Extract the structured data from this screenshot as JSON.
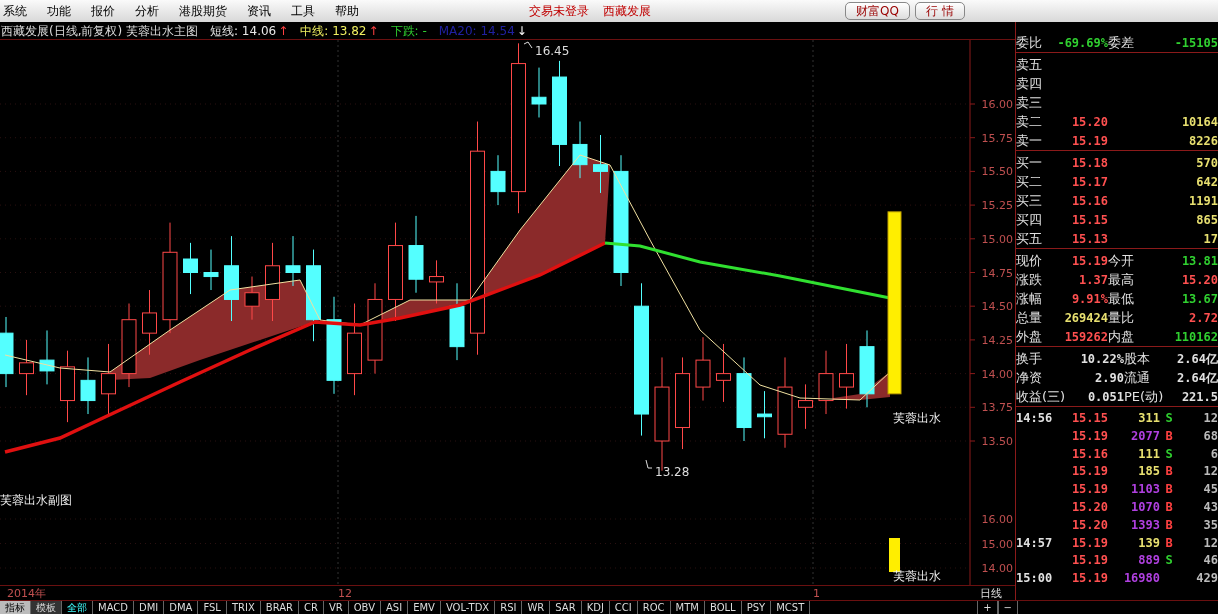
{
  "menu_bar": {
    "items": [
      "系统",
      "功能",
      "报价",
      "分析",
      "港股期货",
      "资讯",
      "工具",
      "帮助"
    ],
    "login_status": "交易未登录",
    "stock_name": "西藏发展",
    "buttons": [
      "财富QQ",
      "行 情"
    ]
  },
  "chart_header": {
    "title": "西藏发展(日线,前复权) 芙蓉出水主图",
    "indicators": [
      {
        "label": "短线:",
        "value": "14.06",
        "arrow": "↑",
        "color": "#e8e8e8"
      },
      {
        "label": "中线:",
        "value": "13.82",
        "arrow": "↑",
        "color": "#f0f060"
      },
      {
        "label": "下跌:",
        "value": "-",
        "color": "#30d030"
      },
      {
        "label": "MA20:",
        "value": "14.54",
        "arrow": "↓",
        "color": "#2020a0"
      }
    ]
  },
  "main_chart": {
    "y_axis": [
      "16.00",
      "15.75",
      "15.50",
      "15.25",
      "15.00",
      "14.75",
      "14.50",
      "14.25",
      "14.00",
      "13.75",
      "13.50"
    ],
    "high_label": "16.45",
    "low_label": "13.28",
    "signal_label": "芙蓉出水"
  },
  "sub_chart": {
    "title": "芙蓉出水副图",
    "y_axis": [
      "16.00",
      "15.00",
      "14.00"
    ],
    "signal_label": "芙蓉出水"
  },
  "date_axis": [
    "2014年",
    "12",
    "1"
  ],
  "period": "日线",
  "quote_panel": {
    "commission": {
      "label": "委比",
      "value": "-69.69%",
      "label2": "委差",
      "value2": "-15105"
    },
    "asks": [
      {
        "label": "卖五"
      },
      {
        "label": "卖四"
      },
      {
        "label": "卖三"
      },
      {
        "label": "卖二",
        "price": "15.20",
        "volume": "10164"
      },
      {
        "label": "卖一",
        "price": "15.19",
        "volume": "8226"
      }
    ],
    "bids": [
      {
        "label": "买一",
        "price": "15.18",
        "volume": "570"
      },
      {
        "label": "买二",
        "price": "15.17",
        "volume": "642"
      },
      {
        "label": "买三",
        "price": "15.16",
        "volume": "1191"
      },
      {
        "label": "买四",
        "price": "15.15",
        "volume": "865"
      },
      {
        "label": "买五",
        "price": "15.13",
        "volume": "17"
      }
    ],
    "stats": [
      {
        "cells": [
          {
            "label": "现价",
            "value": "15.19",
            "color": "#ff5050"
          },
          {
            "label": "今开",
            "value": "13.81",
            "color": "#30d030"
          }
        ]
      },
      {
        "cells": [
          {
            "label": "涨跌",
            "value": "1.37",
            "color": "#ff5050"
          },
          {
            "label": "最高",
            "value": "15.20",
            "color": "#ff5050"
          }
        ]
      },
      {
        "cells": [
          {
            "label": "涨幅",
            "value": "9.91%",
            "color": "#ff5050"
          },
          {
            "label": "最低",
            "value": "13.67",
            "color": "#30d030"
          }
        ]
      },
      {
        "cells": [
          {
            "label": "总量",
            "value": "269424",
            "color": "#e8e070"
          },
          {
            "label": "量比",
            "value": "2.72",
            "color": "#ff5050"
          }
        ]
      },
      {
        "cells": [
          {
            "label": "外盘",
            "value": "159262",
            "color": "#ff5050"
          },
          {
            "label": "内盘",
            "value": "110162",
            "color": "#30d030"
          }
        ]
      }
    ],
    "fundamentals": [
      {
        "label": "换手",
        "value": "10.22%",
        "label2": "股本",
        "value2": "2.64亿"
      },
      {
        "label": "净资",
        "value": "2.90",
        "label2": "流通",
        "value2": "2.64亿"
      },
      {
        "label": "收益(三)",
        "value": "0.051",
        "label2": "PE(动)",
        "value2": "221.5"
      }
    ],
    "ticks": [
      {
        "time": "14:56",
        "price": "15.15",
        "volume": {
          "text": "311",
          "color": "#e8e070"
        },
        "side": {
          "text": "S",
          "kind": "sell"
        },
        "count": "12"
      },
      {
        "price": "15.19",
        "volume": {
          "text": "2077",
          "color": "#b040e0"
        },
        "side": {
          "text": "B",
          "kind": "buy"
        },
        "count": "68"
      },
      {
        "price": "15.16",
        "volume": {
          "text": "111",
          "color": "#e8e070"
        },
        "side": {
          "text": "S",
          "kind": "sell"
        },
        "count": "6"
      },
      {
        "price": "15.19",
        "volume": {
          "text": "185",
          "color": "#e8e070"
        },
        "side": {
          "text": "B",
          "kind": "buy"
        },
        "count": "12"
      },
      {
        "price": "15.19",
        "volume": {
          "text": "1103",
          "color": "#b040e0"
        },
        "side": {
          "text": "B",
          "kind": "buy"
        },
        "count": "45"
      },
      {
        "price": "15.20",
        "volume": {
          "text": "1070",
          "color": "#b040e0"
        },
        "side": {
          "text": "B",
          "kind": "buy"
        },
        "count": "43"
      },
      {
        "price": "15.20",
        "volume": {
          "text": "1393",
          "color": "#b040e0"
        },
        "side": {
          "text": "B",
          "kind": "buy"
        },
        "count": "35"
      },
      {
        "time": "14:57",
        "price": "15.19",
        "volume": {
          "text": "139",
          "color": "#e8e070"
        },
        "side": {
          "text": "B",
          "kind": "buy"
        },
        "count": "12"
      },
      {
        "price": "15.19",
        "volume": {
          "text": "889",
          "color": "#b040e0"
        },
        "side": {
          "text": "S",
          "kind": "sell"
        },
        "count": "46"
      },
      {
        "time": "15:00",
        "price": "15.19",
        "volume": {
          "text": "16980",
          "color": "#b040e0"
        },
        "count": "429"
      }
    ]
  },
  "view_tabs": [
    {
      "label": "指标",
      "selected": true
    },
    {
      "label": "模板",
      "selected": false
    }
  ],
  "indicator_tabs": [
    {
      "label": "全部",
      "selected": true
    },
    {
      "label": "MACD",
      "selected": false
    },
    {
      "label": "DMI",
      "selected": false
    },
    {
      "label": "DMA",
      "selected": false
    },
    {
      "label": "FSL",
      "selected": false
    },
    {
      "label": "TRIX",
      "selected": false
    },
    {
      "label": "BRAR",
      "selected": false
    },
    {
      "label": "CR",
      "selected": false
    },
    {
      "label": "VR",
      "selected": false
    },
    {
      "label": "OBV",
      "selected": false
    },
    {
      "label": "ASI",
      "selected": false
    },
    {
      "label": "EMV",
      "selected": false
    },
    {
      "label": "VOL-TDX",
      "selected": false
    },
    {
      "label": "RSI",
      "selected": false
    },
    {
      "label": "WR",
      "selected": false
    },
    {
      "label": "SAR",
      "selected": false
    },
    {
      "label": "KDJ",
      "selected": false
    },
    {
      "label": "CCI",
      "selected": false
    },
    {
      "label": "ROC",
      "selected": false
    },
    {
      "label": "MTM",
      "selected": false
    },
    {
      "label": "BOLL",
      "selected": false
    },
    {
      "label": "PSY",
      "selected": false
    },
    {
      "label": "MCST",
      "selected": false
    }
  ],
  "zoom_buttons": [
    "+",
    "−"
  ]
}
